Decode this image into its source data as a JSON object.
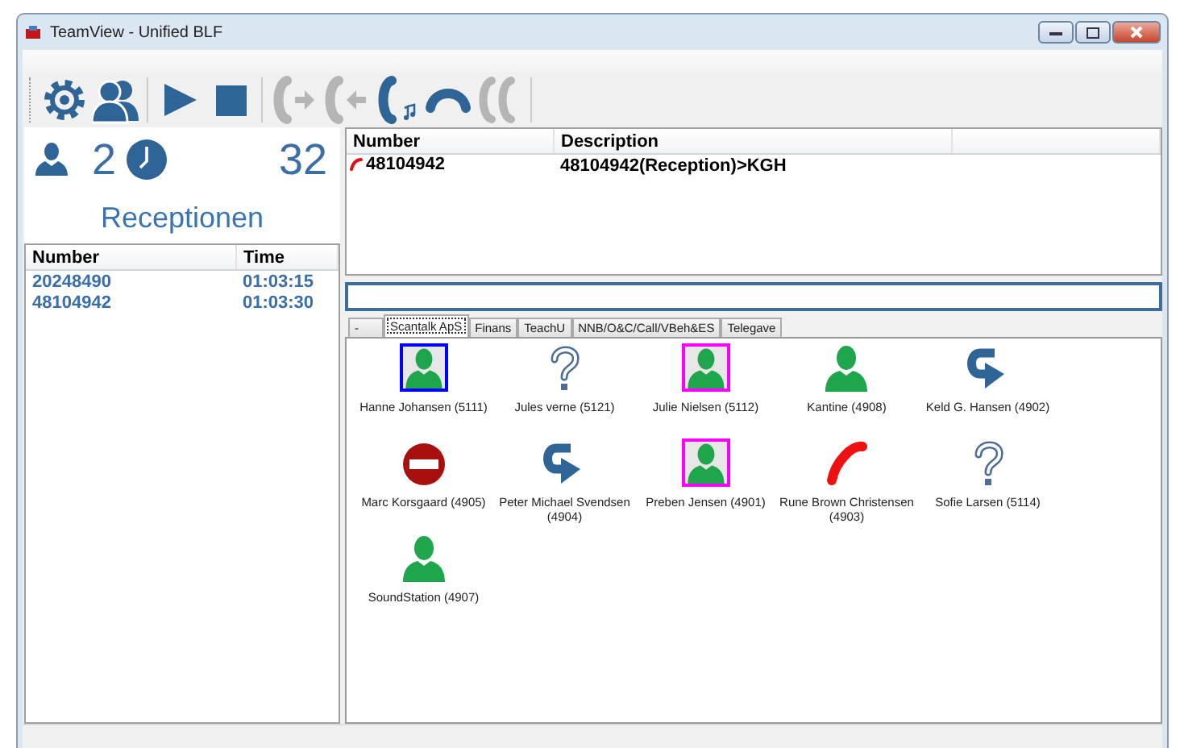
{
  "window": {
    "title": "TeamView - Unified BLF"
  },
  "toolbar": [
    {
      "kind": "settings",
      "disabled": false
    },
    {
      "kind": "contacts",
      "disabled": false
    },
    {
      "kind": "play",
      "disabled": false
    },
    {
      "kind": "stop",
      "disabled": false
    },
    {
      "kind": "transfer-out",
      "disabled": true
    },
    {
      "kind": "transfer-in",
      "disabled": true
    },
    {
      "kind": "phone-note",
      "disabled": false
    },
    {
      "kind": "hangup",
      "disabled": false
    },
    {
      "kind": "conference",
      "disabled": true
    }
  ],
  "stats": {
    "users": "2",
    "waiting": "32"
  },
  "queue_name": "Receptionen",
  "queue_table": {
    "columns": [
      "Number",
      "Time"
    ],
    "rows": [
      {
        "number": "20248490",
        "time": "01:03:15"
      },
      {
        "number": "48104942",
        "time": "01:03:30"
      }
    ]
  },
  "calls_table": {
    "columns": [
      "Number",
      "Description"
    ],
    "rows": [
      {
        "number": "48104942",
        "description": "48104942(Reception)>KGH"
      }
    ]
  },
  "tabs": [
    {
      "label": "-",
      "selected": false
    },
    {
      "label": "Scantalk ApS",
      "selected": true
    },
    {
      "label": "Finans",
      "selected": false
    },
    {
      "label": "TeachU",
      "selected": false
    },
    {
      "label": "NNB/O&C/Call/VBeh&ES",
      "selected": false
    },
    {
      "label": "Telegave",
      "selected": false
    }
  ],
  "contacts": [
    {
      "name": "Hanne Johansen (5111)",
      "kind": "available",
      "color": "#0000ff"
    },
    {
      "name": "Jules verne (5121)",
      "kind": "unknown"
    },
    {
      "name": "Julie Nielsen (5112)",
      "kind": "available",
      "color": "#ff00ff"
    },
    {
      "name": "Kantine (4908)",
      "kind": "available"
    },
    {
      "name": "Keld G. Hansen (4902)",
      "kind": "forwarded"
    },
    {
      "name": "Marc Korsgaard (4905)",
      "kind": "dnd"
    },
    {
      "name": "Peter Michael Svendsen (4904)",
      "kind": "forwarded"
    },
    {
      "name": "Preben Jensen (4901)",
      "kind": "available",
      "color": "#ff00ff"
    },
    {
      "name": "Rune Brown Christensen (4903)",
      "kind": "busy"
    },
    {
      "name": "Sofie Larsen (5114)",
      "kind": "unknown"
    },
    {
      "name": "SoundStation (4907)",
      "kind": "available"
    }
  ]
}
